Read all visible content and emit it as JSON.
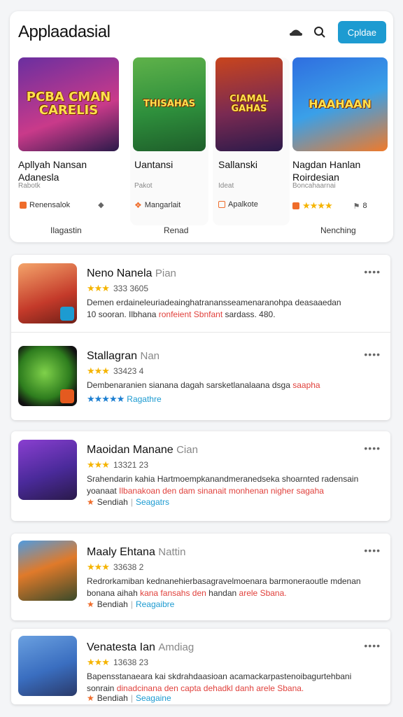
{
  "header": {
    "title": "Applaadasial",
    "button_label": "Cpldae",
    "icons": [
      "hat-icon",
      "search-icon"
    ]
  },
  "featured": [
    {
      "thumb_text": "PCBA CMAN CARELIS",
      "name": "Apllyah Nansan Adanesla",
      "sub": "Rabotk",
      "row_label": "Renensalok",
      "row_color": "#ef6c2a",
      "row_icon": "pin-icon"
    },
    {
      "thumb_text": "THISAHAS",
      "name": "Uantansi",
      "sub": "Pakot",
      "row_label": "Mangarlait",
      "row_color": "#ef6c2a",
      "row_icon": "leaf-icon"
    },
    {
      "thumb_text": "CIAMAL GAHAS",
      "name": "Sallanski",
      "sub": "Ideat",
      "row_label": "Apalkote",
      "row_color": "#ef6c2a",
      "row_icon": "box-icon"
    },
    {
      "thumb_text": "HAAHAAN",
      "name": "Nagdan Hanlan Roirdesian",
      "sub": "Boncahaarnai",
      "row_label": "8",
      "rating_stars": "★★★★",
      "row_color": "#ef6c2a",
      "row_icon": "tag-icon"
    }
  ],
  "tabs": [
    "Ilagastin",
    "Renad",
    "Nenching"
  ],
  "list": [
    {
      "name": "Neno Nanela",
      "dev": "Pian",
      "stars": "★★★",
      "rating": "333 3605",
      "desc": "Demen erdaineleuriadeainghatranansseamenaranohpa deasaaedan",
      "desc2_black": "10 sooran. Ilbhana ",
      "desc2_red": "ronfeient Sbnfant",
      "desc2_tail": " sardass. 480."
    },
    {
      "name": "Stallagran",
      "dev": "Nan",
      "stars": "★★★",
      "rating": "33423 4",
      "desc": "Dembenaranien sianana dagah sarsketlanalaana dsga ",
      "desc_red": "saapha",
      "meta_stars": "★★★★★",
      "meta_label": "Ragathre"
    },
    {
      "name": "Maoidan Manane",
      "dev": "Cian",
      "stars": "★★★",
      "rating": "13321 23",
      "desc": "Srahendarin kahia Hartmoempkanandmeranedseka shoarnted radensain",
      "desc2_black": "yoanaat ",
      "desc2_red": "Ilbanakoan den dam sinanait monhenan nigher sagaha",
      "meta_label": "Sendiah",
      "meta_blue": "Seagatrs"
    },
    {
      "name": "Maaly Ehtana",
      "dev": "Nattin",
      "stars": "★★★",
      "rating": "33638 2",
      "desc": "Redrorkamiban kednanehierbasagravelmoenara barmoneraoutle mdenan",
      "desc2_black": "bonana aihah ",
      "desc2_red": "kana fansahs den",
      "desc2_tail": " handan ",
      "desc2_red2": "arele Sbana.",
      "meta_label": "Bendiah",
      "meta_blue": "Reagaibre"
    },
    {
      "name": "Venatesta Ian",
      "dev": "Amdiag",
      "stars": "★★★",
      "rating": "13638 23",
      "desc": "Bapensstanaeara kai skdrahdaasioan acamackarpastenoibagurtehbani",
      "desc2_black": "sonrain ",
      "desc2_red": "dinadcinana den capta dehadkl danh",
      "desc2_tail": " ",
      "desc2_red2": "arele Sbana.",
      "meta_label": "Bendiah",
      "meta_blue": "Seagaine"
    }
  ],
  "colors": {
    "accent": "#1d9bd1",
    "star": "#f5b400",
    "red": "#e0413c"
  }
}
